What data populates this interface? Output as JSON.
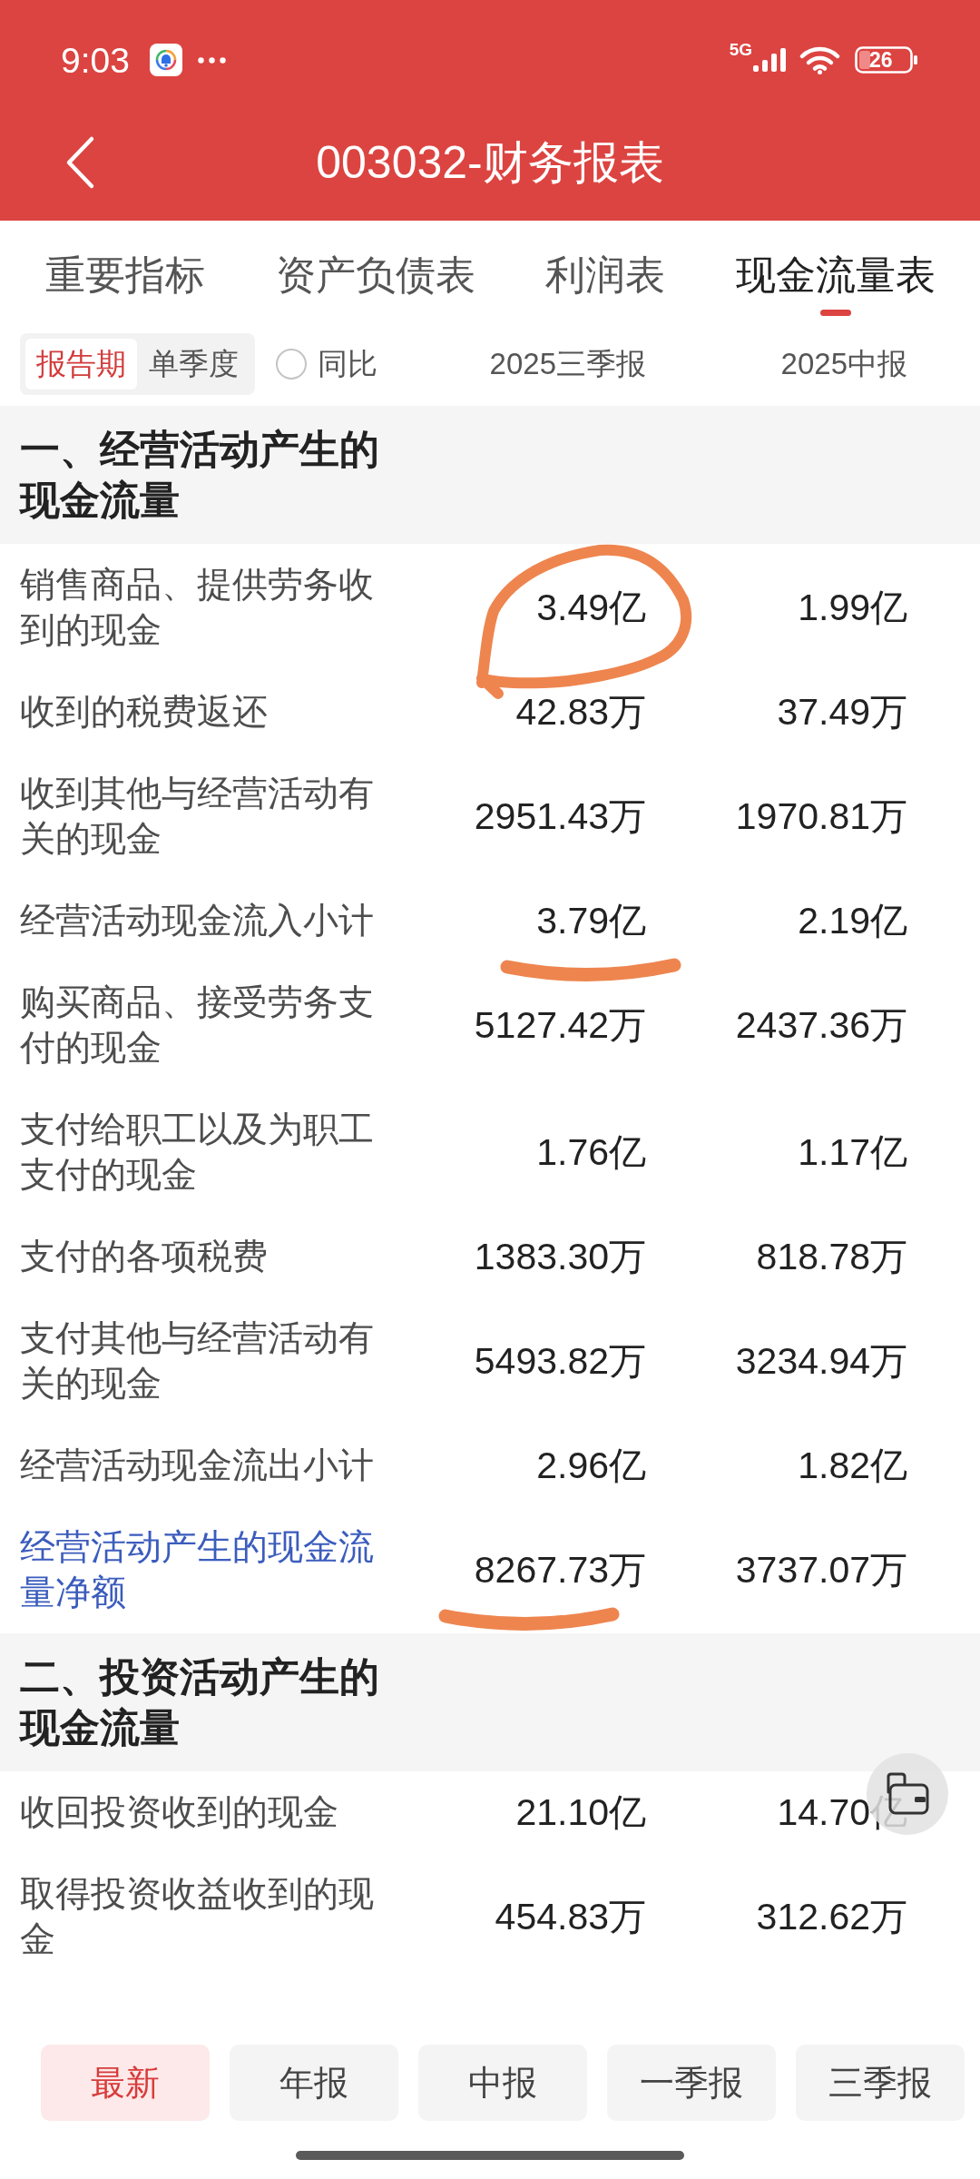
{
  "status_bar": {
    "time": "9:03",
    "network": "5G",
    "battery": "26"
  },
  "header": {
    "title": "003032-财务报表"
  },
  "tabs": [
    {
      "label": "重要指标",
      "selected": false
    },
    {
      "label": "资产负债表",
      "selected": false
    },
    {
      "label": "利润表",
      "selected": false
    },
    {
      "label": "现金流量表",
      "selected": true
    }
  ],
  "filters": {
    "period_modes": [
      {
        "label": "报告期",
        "selected": true
      },
      {
        "label": "单季度",
        "selected": false
      }
    ],
    "yoy": {
      "label": "同比",
      "checked": false
    }
  },
  "table": {
    "columns": [
      "2025三季报",
      "2025中报"
    ],
    "sections": [
      {
        "title": "一、经营活动产生的现金流量",
        "rows": [
          {
            "kind": "item",
            "label": "销售商品、提供劳务收到的现金",
            "values": [
              "3.49亿",
              "1.99亿"
            ],
            "annotation": {
              "kind": "circle"
            }
          },
          {
            "kind": "item",
            "label": "收到的税费返还",
            "values": [
              "42.83万",
              "37.49万"
            ]
          },
          {
            "kind": "item",
            "label": "收到其他与经营活动有关的现金",
            "values": [
              "2951.43万",
              "1970.81万"
            ]
          },
          {
            "kind": "item",
            "label": "经营活动现金流入小计",
            "values": [
              "3.79亿",
              "2.19亿"
            ],
            "annotation": {
              "kind": "underline"
            }
          },
          {
            "kind": "item",
            "label": "购买商品、接受劳务支付的现金",
            "values": [
              "5127.42万",
              "2437.36万"
            ]
          },
          {
            "kind": "item",
            "label": "支付给职工以及为职工支付的现金",
            "values": [
              "1.76亿",
              "1.17亿"
            ]
          },
          {
            "kind": "item",
            "label": "支付的各项税费",
            "values": [
              "1383.30万",
              "818.78万"
            ]
          },
          {
            "kind": "item",
            "label": "支付其他与经营活动有关的现金",
            "values": [
              "5493.82万",
              "3234.94万"
            ]
          },
          {
            "kind": "item",
            "label": "经营活动现金流出小计",
            "values": [
              "2.96亿",
              "1.82亿"
            ]
          },
          {
            "kind": "total",
            "label": "经营活动产生的现金流量净额",
            "values": [
              "8267.73万",
              "3737.07万"
            ],
            "annotation": {
              "kind": "underline"
            }
          }
        ]
      },
      {
        "title": "二、投资活动产生的现金流量",
        "rows": [
          {
            "kind": "item",
            "label": "收回投资收到的现金",
            "values": [
              "21.10亿",
              "14.70亿"
            ]
          },
          {
            "kind": "item",
            "label": "取得投资收益收到的现金",
            "values": [
              "454.83万",
              "312.62万"
            ]
          }
        ]
      }
    ]
  },
  "report_types": [
    {
      "label": "最新",
      "selected": true
    },
    {
      "label": "年报",
      "selected": false
    },
    {
      "label": "中报",
      "selected": false
    },
    {
      "label": "一季报",
      "selected": false
    },
    {
      "label": "三季报",
      "selected": false
    }
  ]
}
